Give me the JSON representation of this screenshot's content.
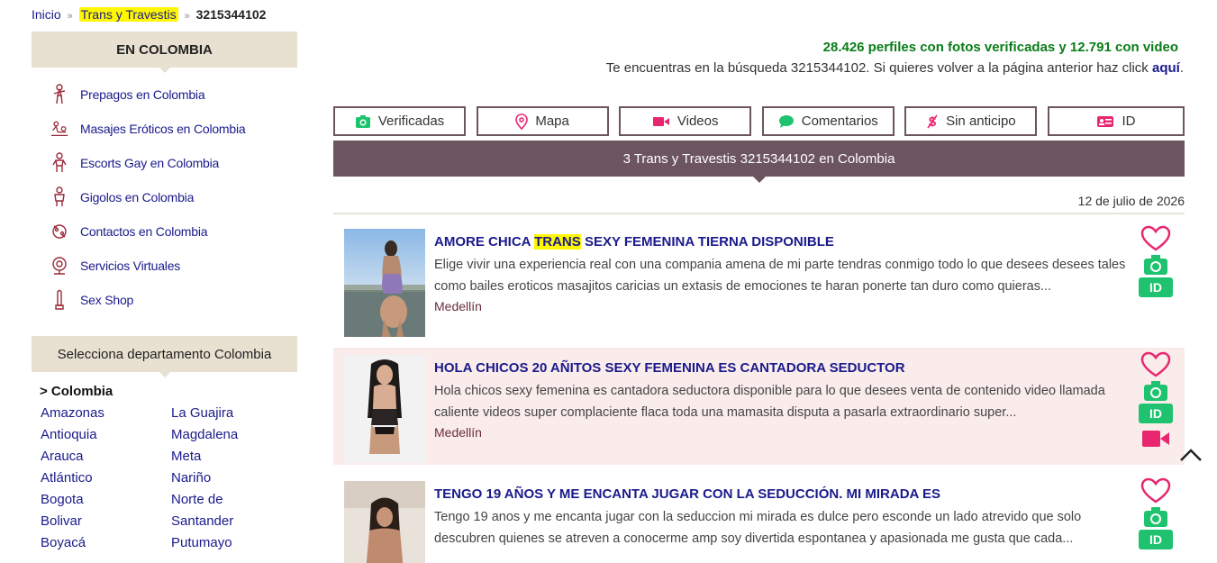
{
  "breadcrumb": {
    "home": "Inicio",
    "section": "Trans y Travestis",
    "current": "3215344102",
    "sep": "»"
  },
  "sidebar": {
    "heading": "EN COLOMBIA",
    "items": [
      {
        "label": "Prepagos en Colombia",
        "icon": "woman-icon"
      },
      {
        "label": "Masajes Eróticos en Colombia",
        "icon": "massage-icon"
      },
      {
        "label": "Escorts Gay en Colombia",
        "icon": "man-icon"
      },
      {
        "label": "Gigolos en Colombia",
        "icon": "gigolo-icon"
      },
      {
        "label": "Contactos en Colombia",
        "icon": "contacts-icon"
      },
      {
        "label": "Servicios Virtuales",
        "icon": "webcam-icon"
      },
      {
        "label": "Sex Shop",
        "icon": "toy-icon"
      }
    ],
    "dept_heading": "Selecciona departamento Colombia",
    "dept_current": "> Colombia",
    "dept_col1": [
      "Amazonas",
      "Antioquia",
      "Arauca",
      "Atlántico",
      "Bogota",
      "Bolivar",
      "Boyacá"
    ],
    "dept_col2": [
      "La Guajira",
      "Magdalena",
      "Meta",
      "Nariño",
      "Norte de",
      "Santander",
      "Putumayo"
    ]
  },
  "header": {
    "stats": "28.426 perfiles con fotos verificadas y 12.791 con video",
    "search_note": "Te encuentras en la búsqueda 3215344102. Si quieres volver a la página anterior haz click",
    "search_link": "aquí",
    "search_tail": "."
  },
  "filters": [
    {
      "label": "Verificadas",
      "icon": "camera-icon"
    },
    {
      "label": "Mapa",
      "icon": "map-pin-icon"
    },
    {
      "label": "Videos",
      "icon": "video-icon"
    },
    {
      "label": "Comentarios",
      "icon": "comment-icon"
    },
    {
      "label": "Sin anticipo",
      "icon": "no-deposit-icon"
    },
    {
      "label": "ID",
      "icon": "id-card-icon"
    }
  ],
  "results_title": "3 Trans y Travestis 3215344102 en Colombia",
  "date": "12 de julio de 2026",
  "listings": [
    {
      "title_pre": "AMORE CHICA ",
      "title_hl": "TRANS",
      "title_post": " SEXY FEMENINA TIERNA DISPONIBLE",
      "desc": "Elige vivir una experiencia real con una compania amena de mi parte tendras conmigo todo lo que desees desees tales como bailes eroticos masajitos caricias un extasis de emociones te haran ponerte tan duro como quieras...",
      "city": "Medellín",
      "id_label": "ID",
      "has_video": false
    },
    {
      "title_pre": "HOLA CHICOS 20 AÑITOS SEXY FEMENINA ES CANTADORA SEDUCTOR",
      "title_hl": "",
      "title_post": "",
      "desc": "Hola chicos sexy femenina es cantadora seductora disponible para lo que desees venta de contenido video llamada caliente videos super complaciente flaca toda una mamasita disputa a pasarla extraordinario super...",
      "city": "Medellín",
      "id_label": "ID",
      "has_video": true
    },
    {
      "title_pre": "TENGO 19 AÑOS Y ME ENCANTA JUGAR CON LA SEDUCCIÓN. MI MIRADA ES",
      "title_hl": "",
      "title_post": "",
      "desc": "Tengo 19 anos y me encanta jugar con la seduccion mi mirada es dulce pero esconde un lado atrevido que solo descubren quienes se atreven a conocerme amp soy divertida espontanea y apasionada me gusta que cada...",
      "city": "",
      "id_label": "ID",
      "has_video": false
    }
  ],
  "colors": {
    "accent": "#6d5560",
    "link": "#1a1a8c",
    "green": "#1fc36f",
    "pink": "#e8266f",
    "highlight": "#fff700"
  }
}
